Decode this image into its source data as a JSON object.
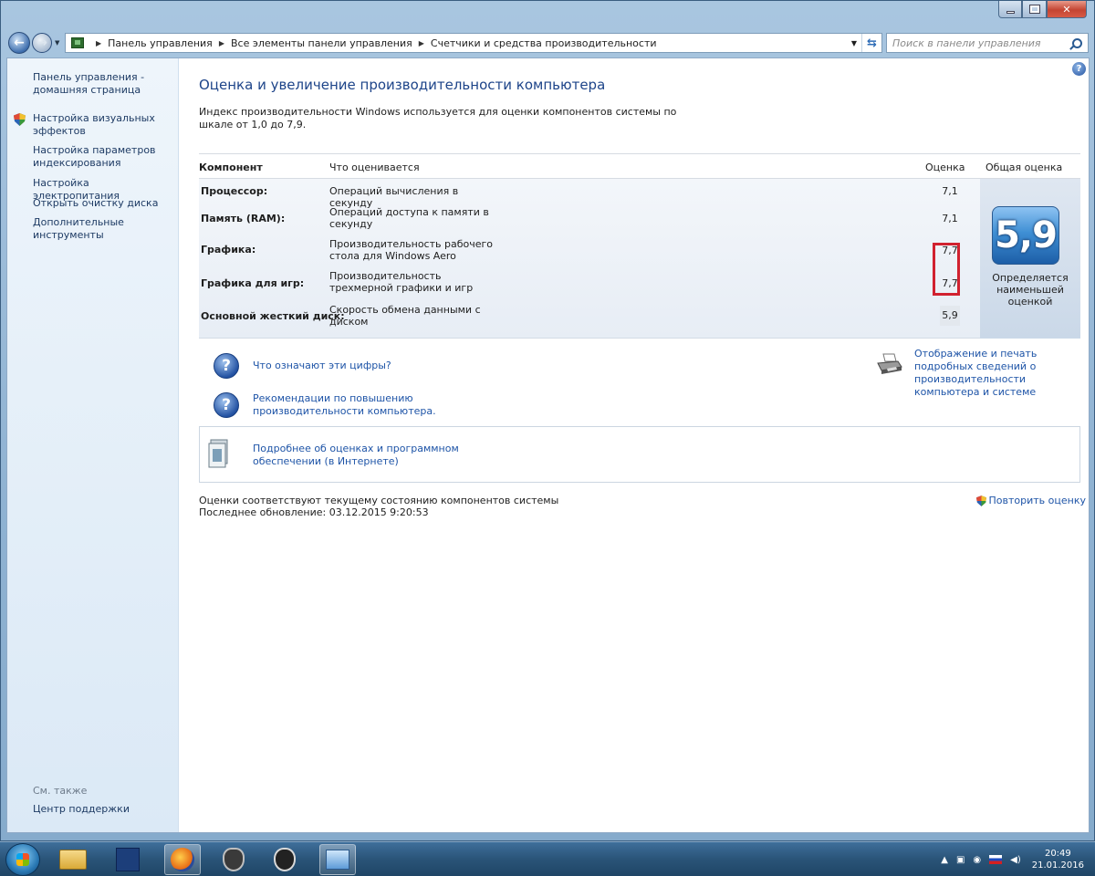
{
  "window": {
    "breadcrumb": [
      "Панель управления",
      "Все элементы панели управления",
      "Счетчики и средства производительности"
    ],
    "search_placeholder": "Поиск в панели управления"
  },
  "sidebar": {
    "items": [
      {
        "label": "Панель управления - домашняя страница",
        "icon": ""
      },
      {
        "label": "Настройка визуальных эффектов",
        "icon": "shield-icon"
      },
      {
        "label": "Настройка параметров индексирования",
        "icon": ""
      },
      {
        "label": "Настройка электропитания",
        "icon": ""
      },
      {
        "label": "Открыть очистку диска",
        "icon": ""
      },
      {
        "label": "Дополнительные инструменты",
        "icon": ""
      }
    ],
    "see_also": "См. также",
    "support": "Центр поддержки"
  },
  "main": {
    "title": "Оценка и увеличение производительности компьютера",
    "intro": "Индекс производительности Windows используется для оценки компонентов системы по шкале от 1,0 до 7,9.",
    "table": {
      "headers": {
        "component": "Компонент",
        "what": "Что оценивается",
        "score": "Оценка",
        "overall": "Общая оценка"
      },
      "rows": [
        {
          "component": "Процессор:",
          "what": "Операций вычисления в секунду",
          "score": "7,1"
        },
        {
          "component": "Память (RAM):",
          "what": "Операций доступа к памяти в секунду",
          "score": "7,1"
        },
        {
          "component": "Графика:",
          "what": "Производительность рабочего стола для Windows Aero",
          "score": "7,7"
        },
        {
          "component": "Графика для игр:",
          "what": "Производительность трехмерной графики и игр",
          "score": "7,7"
        },
        {
          "component": "Основной жесткий диск:",
          "what": "Скорость обмена данными с диском",
          "score": "5,9"
        }
      ],
      "overall_score": "5,9",
      "overall_note": "Определяется наименьшей оценкой"
    },
    "links": {
      "what_numbers": "Что означают эти цифры?",
      "tips": "Рекомендации по повышению производительности компьютера.",
      "print": "Отображение и печать подробных сведений о производительности компьютера и системе",
      "more_online": "Подробнее об оценках и программном обеспечении (в Интернете)"
    },
    "status_line1": "Оценки соответствуют текущему состоянию компонентов системы",
    "status_line2": "Последнее обновление: 03.12.2015 9:20:53",
    "repeat": "Повторить оценку"
  },
  "taskbar": {
    "time": "20:49",
    "date": "21.01.2016"
  },
  "colors": {
    "accent": "#1e54a7",
    "highlight": "#d1212f"
  }
}
